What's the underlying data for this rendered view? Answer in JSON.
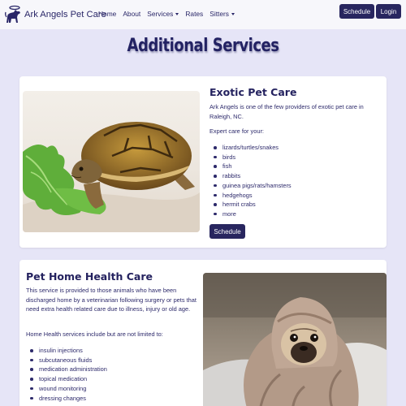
{
  "navbar": {
    "brand": "Ark Angels Pet Care",
    "links": [
      {
        "label": "Home",
        "dropdown": false
      },
      {
        "label": "About",
        "dropdown": false
      },
      {
        "label": "Services",
        "dropdown": true
      },
      {
        "label": "Rates",
        "dropdown": false
      },
      {
        "label": "Sitters",
        "dropdown": true
      }
    ],
    "schedule_label": "Schedule",
    "login_label": "Login"
  },
  "page": {
    "title": "Additional Services"
  },
  "sections": {
    "exotic": {
      "title": "Exotic Pet Care",
      "intro": "Ark Angels is one of the few providers of exotic pet care in Raleigh, NC.",
      "list_heading": "Expert care for your:",
      "items": [
        "lizards/turtles/snakes",
        "birds",
        "fish",
        "rabbits",
        "guinea pigs/rats/hamsters",
        "hedgehogs",
        "hermit crabs",
        "more"
      ],
      "button_label": "Schedule",
      "image": "turtle-eating-lettuce"
    },
    "health": {
      "title": "Pet Home Health Care",
      "intro": "This service is provided to those animals who have been discharged home by a veterinarian following surgery or pets that need extra health related care due to illness, injury or old age.",
      "list_heading": "Home Health services include but are not limited to:",
      "items": [
        "insulin injections",
        "subcutaneous fluids",
        "medication administration",
        "topical medication",
        "wound monitoring",
        "dressing changes"
      ],
      "image": "pug-in-blanket"
    }
  },
  "colors": {
    "background": "#e6e5f7",
    "navbar": "#f7f7fb",
    "brand_dark": "#28265f",
    "text": "#2d2a6b"
  },
  "icons": {
    "logo": "dog-with-halo-logo-icon",
    "dropdown": "caret-down-icon"
  }
}
